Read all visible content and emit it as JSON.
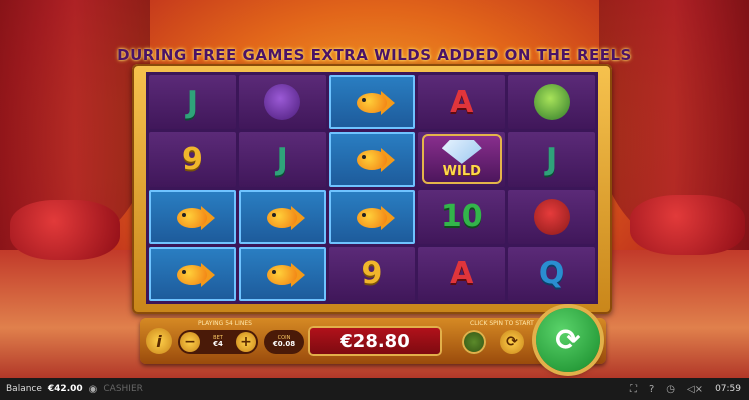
{
  "headline": "DURING FREE GAMES EXTRA WILDS ADDED ON THE REELS",
  "reels": [
    [
      {
        "t": "text",
        "v": "J",
        "cls": "sym-J"
      },
      {
        "t": "bird"
      },
      {
        "t": "fish",
        "win": true
      },
      {
        "t": "text",
        "v": "A",
        "cls": "sym-A"
      },
      {
        "t": "butterfly"
      }
    ],
    [
      {
        "t": "text",
        "v": "9",
        "cls": "sym-9"
      },
      {
        "t": "text",
        "v": "J",
        "cls": "sym-J"
      },
      {
        "t": "fish",
        "win": true
      },
      {
        "t": "wild"
      },
      {
        "t": "text",
        "v": "J",
        "cls": "sym-J"
      }
    ],
    [
      {
        "t": "fish",
        "win": true
      },
      {
        "t": "fish",
        "win": true
      },
      {
        "t": "fish",
        "win": true
      },
      {
        "t": "text",
        "v": "10",
        "cls": "sym-10"
      },
      {
        "t": "parrot"
      }
    ],
    [
      {
        "t": "fish",
        "win": true
      },
      {
        "t": "fish",
        "win": true
      },
      {
        "t": "text",
        "v": "9",
        "cls": "sym-9"
      },
      {
        "t": "text",
        "v": "A",
        "cls": "sym-A"
      },
      {
        "t": "text",
        "v": "Q",
        "cls": "sym-Q"
      }
    ]
  ],
  "wild_label": "WILD",
  "controls": {
    "info": "i",
    "playing_lines": "PLAYING 54 LINES",
    "bet_label": "BET",
    "bet_value": "€4",
    "coin_label": "COIN",
    "coin_value": "€0.08",
    "win_amount": "€28.80",
    "spin_hint": "CLICK SPIN TO START",
    "minus": "−",
    "plus": "+",
    "turbo": "⟳",
    "spin": "⟳"
  },
  "statusbar": {
    "balance_label": "Balance",
    "balance_value": "€42.00",
    "cashier": "CASHIER",
    "help": "?",
    "time": "07:59"
  }
}
